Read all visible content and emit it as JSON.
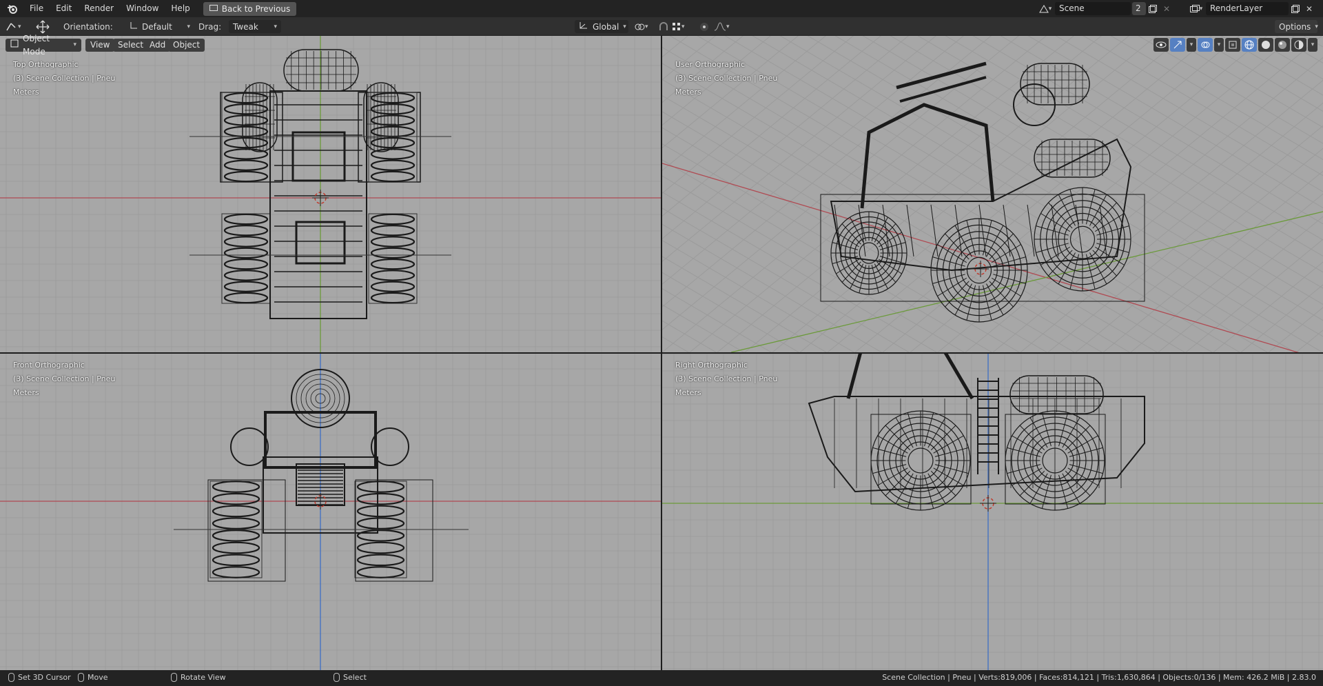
{
  "topbar": {
    "menu": [
      "File",
      "Edit",
      "Render",
      "Window",
      "Help"
    ],
    "back_button": "Back to Previous",
    "scene_name": "Scene",
    "scene_users": "2",
    "render_layer": "RenderLayer"
  },
  "toolbar": {
    "orientation_label": "Orientation:",
    "orientation_value": "Default",
    "drag_label": "Drag:",
    "drag_value": "Tweak",
    "transform_space": "Global",
    "options_label": "Options"
  },
  "viewport_header": {
    "mode": "Object Mode",
    "menus": [
      "View",
      "Select",
      "Add",
      "Object"
    ]
  },
  "viewports": [
    {
      "name": "Top Orthographic",
      "collection": "(3) Scene Collection | Pneu",
      "units": "Meters"
    },
    {
      "name": "User Orthographic",
      "collection": "(3) Scene Collection | Pneu",
      "units": "Meters"
    },
    {
      "name": "Front Orthographic",
      "collection": "(3) Scene Collection | Pneu",
      "units": "Meters"
    },
    {
      "name": "Right Orthographic",
      "collection": "(3) Scene Collection | Pneu",
      "units": "Meters"
    }
  ],
  "statusbar": {
    "left_actions": [
      "Set 3D Cursor",
      "Move",
      "Rotate View",
      "Select"
    ],
    "stats": "Scene Collection | Pneu | Verts:819,006 | Faces:814,121 | Tris:1,630,864 | Objects:0/136 | Mem: 426.2 MiB | 2.83.0"
  },
  "colors": {
    "viewport_bg": "#a7a7a7",
    "x_axis": "#b04a52",
    "y_axis": "#6b9a3a",
    "z_axis": "#3d6fc4",
    "wire": "#1a1a1a"
  }
}
